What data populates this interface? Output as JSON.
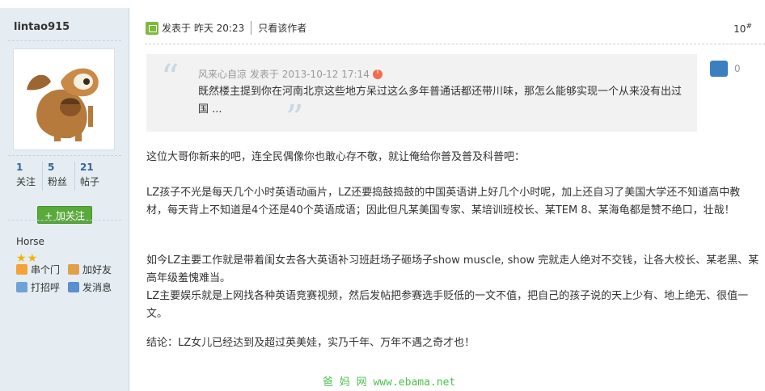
{
  "author": {
    "username": "lintao915",
    "stats": [
      {
        "value": "1",
        "label": "关注"
      },
      {
        "value": "5",
        "label": "粉丝"
      },
      {
        "value": "21",
        "label": "帖子"
      }
    ],
    "follow_label": "+ 加关注",
    "rank": "Horse",
    "stars": 2,
    "actions": [
      {
        "label": "串个门",
        "icon": "home-icon"
      },
      {
        "label": "加好友",
        "icon": "handshake-icon"
      },
      {
        "label": "打招呼",
        "icon": "wave-icon"
      },
      {
        "label": "发消息",
        "icon": "envelope-icon"
      }
    ]
  },
  "post": {
    "posted_prefix": "发表于",
    "posted_time": "昨天 20:23",
    "only_author": "只看该作者",
    "floor": "10",
    "floor_sup": "#",
    "quote": {
      "author": "风来心自凉",
      "posted_label": "发表于",
      "time": "2013-10-12 17:14",
      "text": "既然楼主提到你在河南北京这些地方呆过这么多年普通话都还带川味，那怎么能够实现一个从来没有出过国 ..."
    },
    "like_count": "0",
    "paragraphs": [
      "这位大哥你新来的吧，连全民偶像你也敢心存不敬，就让俺给你普及普及科普吧：",
      "LZ孩子不光是每天几个小时英语动画片，LZ还要捣鼓捣鼓的中国英语讲上好几个小时呢，加上还自习了美国大学还不知道高中教材，每天背上不知道是4个还是40个英语成语；因此但凡某美国专家、某培训班校长、某TEM 8、某海龟都是赞不绝口，壮哉！",
      "如今LZ主要工作就是带着闺女去各大英语补习班赶场子砸场子show muscle, show 完就走人绝对不交钱，让各大校长、某老黑、某高年级羞愧难当。",
      "LZ主要娱乐就是上网找各种英语竞赛视频，然后发帖把参赛选手贬低的一文不值，把自己的孩子说的天上少有、地上绝无、很值一文。",
      "结论：LZ女儿已经达到及超过英美娃，实乃千年、万年不遇之奇才也！"
    ],
    "watermark": "爸 妈 网  www.ebama.net"
  },
  "colors": {
    "sidebar_bg": "#e5edf2",
    "link_blue": "#336699",
    "follow_green": "#5aa93b",
    "star_gold": "#f0b400",
    "watermark_green": "#4cc34b"
  }
}
